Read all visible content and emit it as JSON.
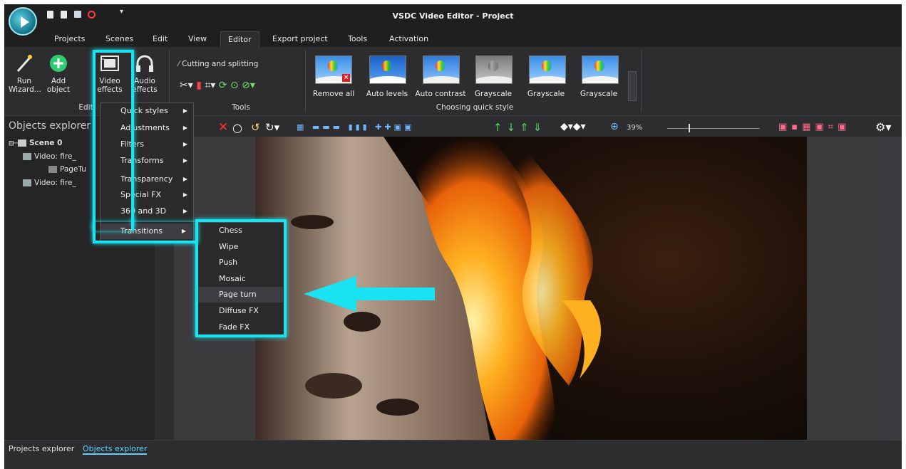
{
  "window": {
    "title": "VSDC Video Editor - Project"
  },
  "menubar": {
    "items": [
      "Projects",
      "Scenes",
      "Edit",
      "View",
      "Editor",
      "Export project",
      "Tools",
      "Activation"
    ],
    "active": "Editor"
  },
  "ribbon": {
    "run_wizard": "Run\nWizard...",
    "add_object": "Add\nobject",
    "video_effects": "Video\neffects",
    "audio_effects": "Audio\neffects",
    "editing_group": "Editi",
    "cutting_splitting": "Cutting and splitting",
    "tools_group": "Tools",
    "quick_style_group": "Choosing quick style",
    "quick_styles": [
      "Remove all",
      "Auto levels",
      "Auto contrast",
      "Grayscale",
      "Grayscale",
      "Grayscale"
    ]
  },
  "objects_explorer": {
    "title": "Objects explorer",
    "tree": [
      "Scene 0",
      "Video: fire_",
      "PageTu",
      "Video: fire_"
    ]
  },
  "video_effects_menu": {
    "items": [
      "Quick styles",
      "Adjustments",
      "Filters",
      "Transforms",
      "Transparency",
      "Special FX",
      "360 and 3D",
      "Transitions"
    ]
  },
  "transitions_submenu": {
    "items": [
      "Chess",
      "Wipe",
      "Push",
      "Mosaic",
      "Page turn",
      "Diffuse FX",
      "Fade FX"
    ],
    "highlighted": "Page turn"
  },
  "toolbar": {
    "zoom": "39%"
  },
  "bottom_tabs": {
    "projects": "Projects explorer",
    "objects": "Objects explorer"
  },
  "colors": {
    "accent_highlight": "#19e3f0",
    "background": "#2d2d30",
    "menu_bg": "#2b2b2b"
  }
}
